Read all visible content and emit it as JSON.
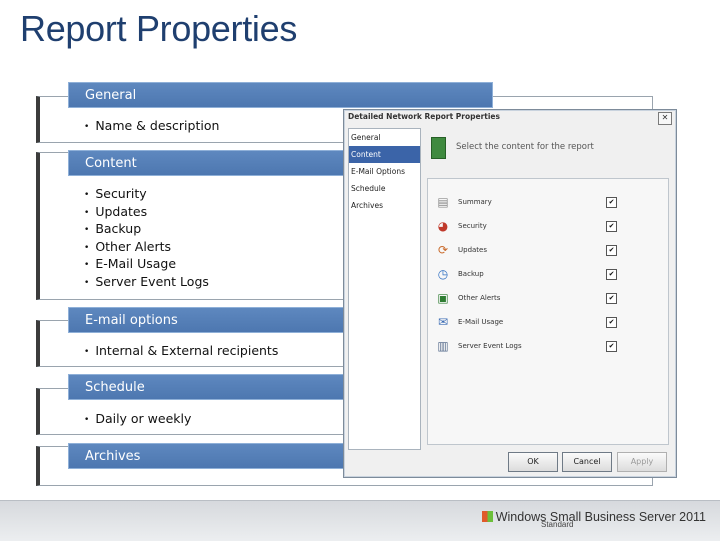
{
  "slide": {
    "title": "Report Properties"
  },
  "sections": [
    {
      "header": "General",
      "bullets": [
        "Name & description"
      ]
    },
    {
      "header": "Content",
      "bullets": [
        "Security",
        "Updates",
        "Backup",
        "Other Alerts",
        "E-Mail Usage",
        "Server Event Logs"
      ]
    },
    {
      "header": "E-mail options",
      "bullets": [
        "Internal & External recipients"
      ]
    },
    {
      "header": "Schedule",
      "bullets": [
        "Daily or weekly"
      ]
    },
    {
      "header": "Archives",
      "bullets": []
    }
  ],
  "dialog": {
    "title": "Detailed Network Report Properties",
    "close_icon": "close-icon",
    "nav": [
      "General",
      "Content",
      "E-Mail Options",
      "Schedule",
      "Archives"
    ],
    "nav_selected": "Content",
    "heading": "Select the content for the report",
    "items": [
      {
        "label": "Summary",
        "icon": "summary-icon",
        "checked": true
      },
      {
        "label": "Security",
        "icon": "security-icon",
        "checked": true
      },
      {
        "label": "Updates",
        "icon": "updates-icon",
        "checked": true
      },
      {
        "label": "Backup",
        "icon": "backup-icon",
        "checked": true
      },
      {
        "label": "Other Alerts",
        "icon": "alerts-icon",
        "checked": true
      },
      {
        "label": "E-Mail Usage",
        "icon": "email-usage-icon",
        "checked": true
      },
      {
        "label": "Server Event Logs",
        "icon": "event-logs-icon",
        "checked": true
      }
    ],
    "buttons": {
      "ok": "OK",
      "cancel": "Cancel",
      "apply": "Apply"
    }
  },
  "footer": {
    "brand": "Windows Small Business Server 2011",
    "edition": "Standard"
  },
  "colors": {
    "title": "#1f3f6f",
    "section_header": "#4d77b0",
    "selection": "#3b64a8"
  }
}
